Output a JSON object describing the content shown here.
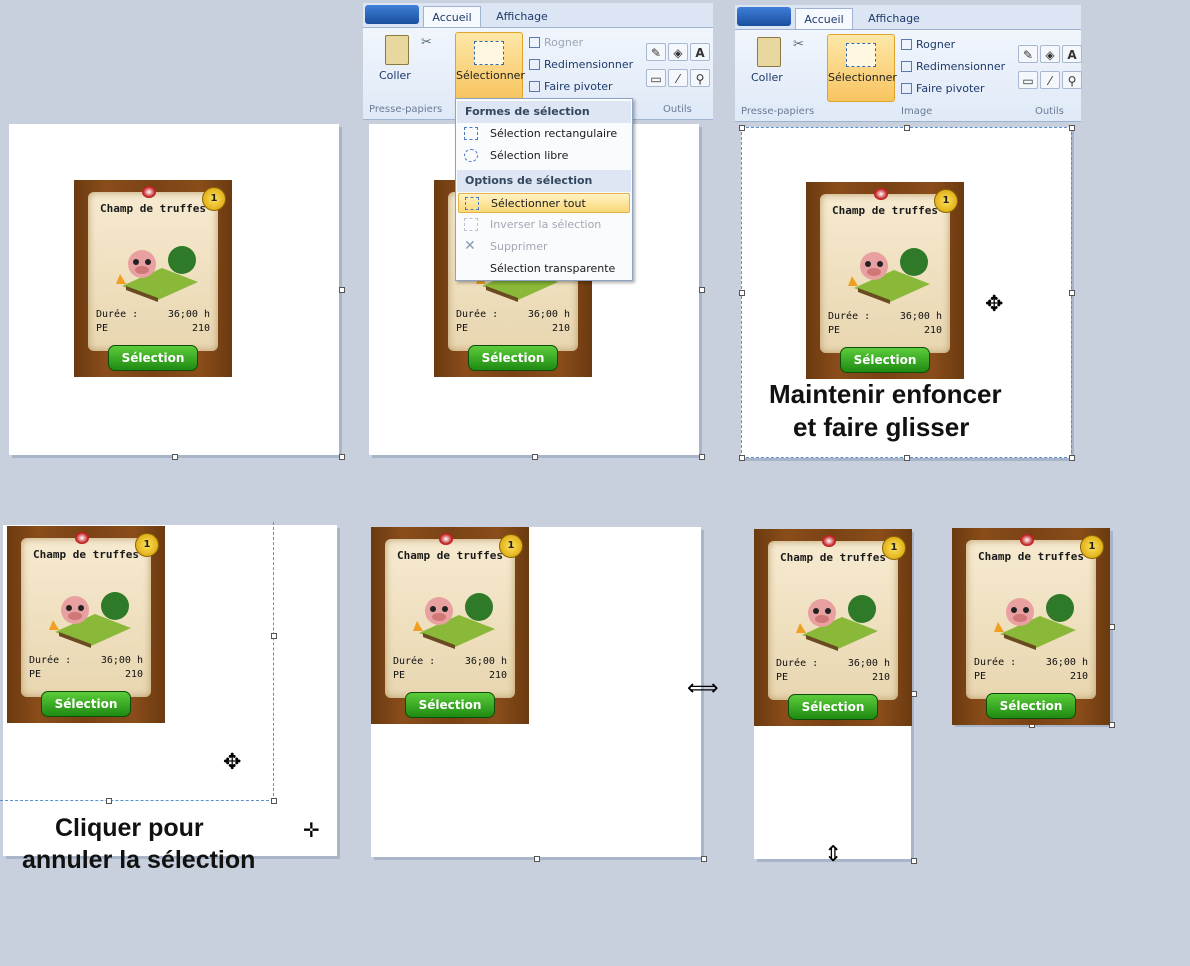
{
  "ribbon": {
    "tab_home": "Accueil",
    "tab_view": "Affichage",
    "paste": "Coller",
    "select": "Sélectionner",
    "crop": "Rogner",
    "resize": "Redimensionner",
    "rotate": "Faire pivoter",
    "group_clipboard": "Presse-papiers",
    "group_image": "Image",
    "group_tools": "Outils"
  },
  "menu": {
    "header_shapes": "Formes de sélection",
    "rect": "Sélection rectangulaire",
    "free": "Sélection libre",
    "header_options": "Options de sélection",
    "select_all": "Sélectionner tout",
    "invert": "Inverser la sélection",
    "delete": "Supprimer",
    "transparent": "Sélection transparente"
  },
  "card": {
    "title": "Champ de truffes",
    "badge": "1",
    "duration_label": "Durée :",
    "duration_value": "36;00 h",
    "pe_label": "PE",
    "pe_value": "210",
    "button": "Sélection"
  },
  "captions": {
    "drag_line1": "Maintenir enfoncer",
    "drag_line2": "et faire glisser",
    "click_line1": "Cliquer pour",
    "click_line2": "annuler la sélection"
  }
}
